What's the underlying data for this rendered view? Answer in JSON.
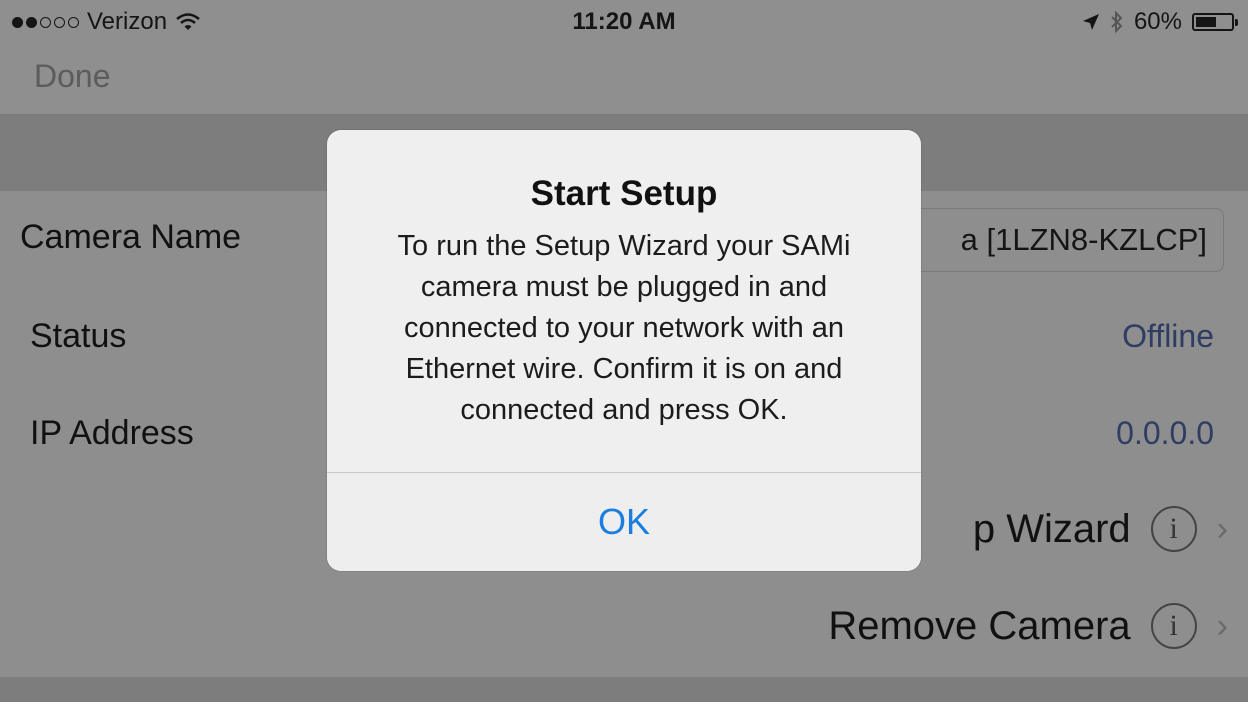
{
  "status_bar": {
    "carrier": "Verizon",
    "time": "11:20 AM",
    "battery": "60%",
    "battery_level": 0.6,
    "signal_bars_filled": 2,
    "signal_bars_total": 5
  },
  "nav": {
    "done_label": "Done"
  },
  "settings": {
    "camera_name_label": "Camera Name",
    "camera_name_value": "a [1LZN8-KZLCP]",
    "status_label": "Status",
    "status_value": "Offline",
    "ip_label": "IP Address",
    "ip_value": "0.0.0.0",
    "setup_wizard_label": "p Wizard",
    "remove_camera_label": "Remove Camera",
    "info_icon": "info-icon",
    "chevron_icon": "chevron-right-icon"
  },
  "alert": {
    "title": "Start Setup",
    "message_lines": [
      "To run the Setup Wizard your SAMi",
      "camera must be plugged in and",
      "connected to your network with an",
      "Ethernet wire.  Confirm it is on and",
      "connected and press OK."
    ],
    "ok_label": "OK"
  },
  "colors": {
    "accent": "#1a7ee0",
    "value_text": "#2f3d63",
    "dimmed_background": "#8e8e8e"
  }
}
